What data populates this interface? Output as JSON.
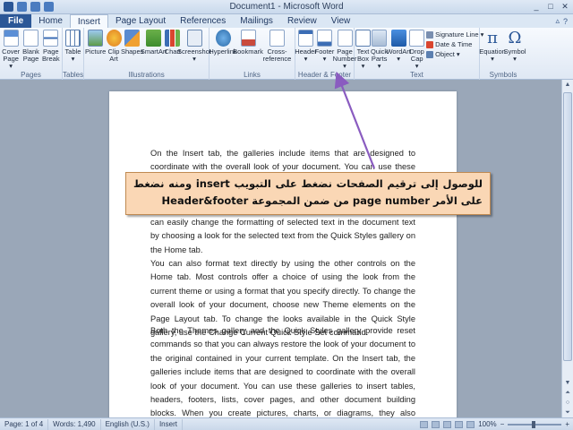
{
  "window": {
    "title": "Document1 - Microsoft Word"
  },
  "tabs": [
    "File",
    "Home",
    "Insert",
    "Page Layout",
    "References",
    "Mailings",
    "Review",
    "View"
  ],
  "active_tab": "Insert",
  "ribbon": {
    "groups": {
      "pages": {
        "label": "Pages",
        "buttons": [
          {
            "label": "Cover\nPage ▾",
            "icon": "cover-page-icon"
          },
          {
            "label": "Blank\nPage",
            "icon": "blank-page-icon"
          },
          {
            "label": "Page\nBreak",
            "icon": "page-break-icon"
          }
        ]
      },
      "tables": {
        "label": "Tables",
        "buttons": [
          {
            "label": "Table\n▾",
            "icon": "table-icon"
          }
        ]
      },
      "illustrations": {
        "label": "Illustrations",
        "buttons": [
          {
            "label": "Picture",
            "icon": "picture-icon"
          },
          {
            "label": "Clip\nArt",
            "icon": "clip-art-icon"
          },
          {
            "label": "Shapes",
            "icon": "shapes-icon"
          },
          {
            "label": "SmartArt",
            "icon": "smartart-icon"
          },
          {
            "label": "Chart",
            "icon": "chart-icon"
          },
          {
            "label": "Screenshot\n▾",
            "icon": "screenshot-icon"
          }
        ]
      },
      "links": {
        "label": "Links",
        "buttons": [
          {
            "label": "Hyperlink",
            "icon": "hyperlink-icon"
          },
          {
            "label": "Bookmark",
            "icon": "bookmark-icon"
          },
          {
            "label": "Cross-reference",
            "icon": "cross-reference-icon"
          }
        ]
      },
      "header_footer": {
        "label": "Header & Footer",
        "buttons": [
          {
            "label": "Header\n▾",
            "icon": "header-icon"
          },
          {
            "label": "Footer\n▾",
            "icon": "footer-icon"
          },
          {
            "label": "Page\nNumber ▾",
            "icon": "page-number-icon"
          }
        ]
      },
      "text": {
        "label": "Text",
        "buttons": [
          {
            "label": "Text\nBox ▾",
            "icon": "text-box-icon"
          },
          {
            "label": "Quick\nParts ▾",
            "icon": "quick-parts-icon"
          },
          {
            "label": "WordArt\n▾",
            "icon": "wordart-icon"
          },
          {
            "label": "Drop\nCap ▾",
            "icon": "drop-cap-icon"
          }
        ],
        "small": [
          "Signature Line ▾",
          "Date & Time",
          "Object ▾"
        ]
      },
      "symbols": {
        "label": "Symbols",
        "buttons": [
          {
            "label": "Equation\n▾",
            "icon": "equation-icon"
          },
          {
            "label": "Symbol\n▾",
            "icon": "symbol-icon"
          }
        ]
      }
    }
  },
  "document": {
    "paragraphs": [
      "On the Insert tab, the galleries include items that are designed to coordinate with the overall look of your document. You can use these galleries to insert tables, headers, footers, lists, cover pages, and other document building blocks. When you create pictures, charts, or diagrams, they also coordinate with your current document look. You can easily change the formatting of selected text in the document text by choosing a look for the selected text from the Quick Styles gallery on the Home tab.",
      "You can also format text directly by using the other controls on the Home tab. Most controls offer a choice of using the look from the current theme or using a format that you specify directly. To change the overall look of your document, choose new Theme elements on the Page Layout tab. To change the looks available in the Quick Style gallery, use the Change Current Quick Style Set command.",
      "Both the Themes gallery and the Quick Styles gallery provide reset commands so that you can always restore the look of your document to the original contained in your current template. On the Insert tab, the galleries include items that are designed to coordinate with the overall look of your document. You can use these galleries to insert tables, headers, footers, lists, cover pages, and other document building blocks. When you create pictures, charts, or diagrams, they also coordinate with your current document look."
    ]
  },
  "callout": {
    "text": "للوصول إلى ترقيم الصفحات نضغط على التبويب insert ومنه نضغط على الأمر page number من ضمن المجموعة Header&footer"
  },
  "status": {
    "page": "Page: 1 of 4",
    "words": "Words: 1,490",
    "language": "English (U.S.)",
    "mode": "Insert",
    "zoom": "100%"
  }
}
